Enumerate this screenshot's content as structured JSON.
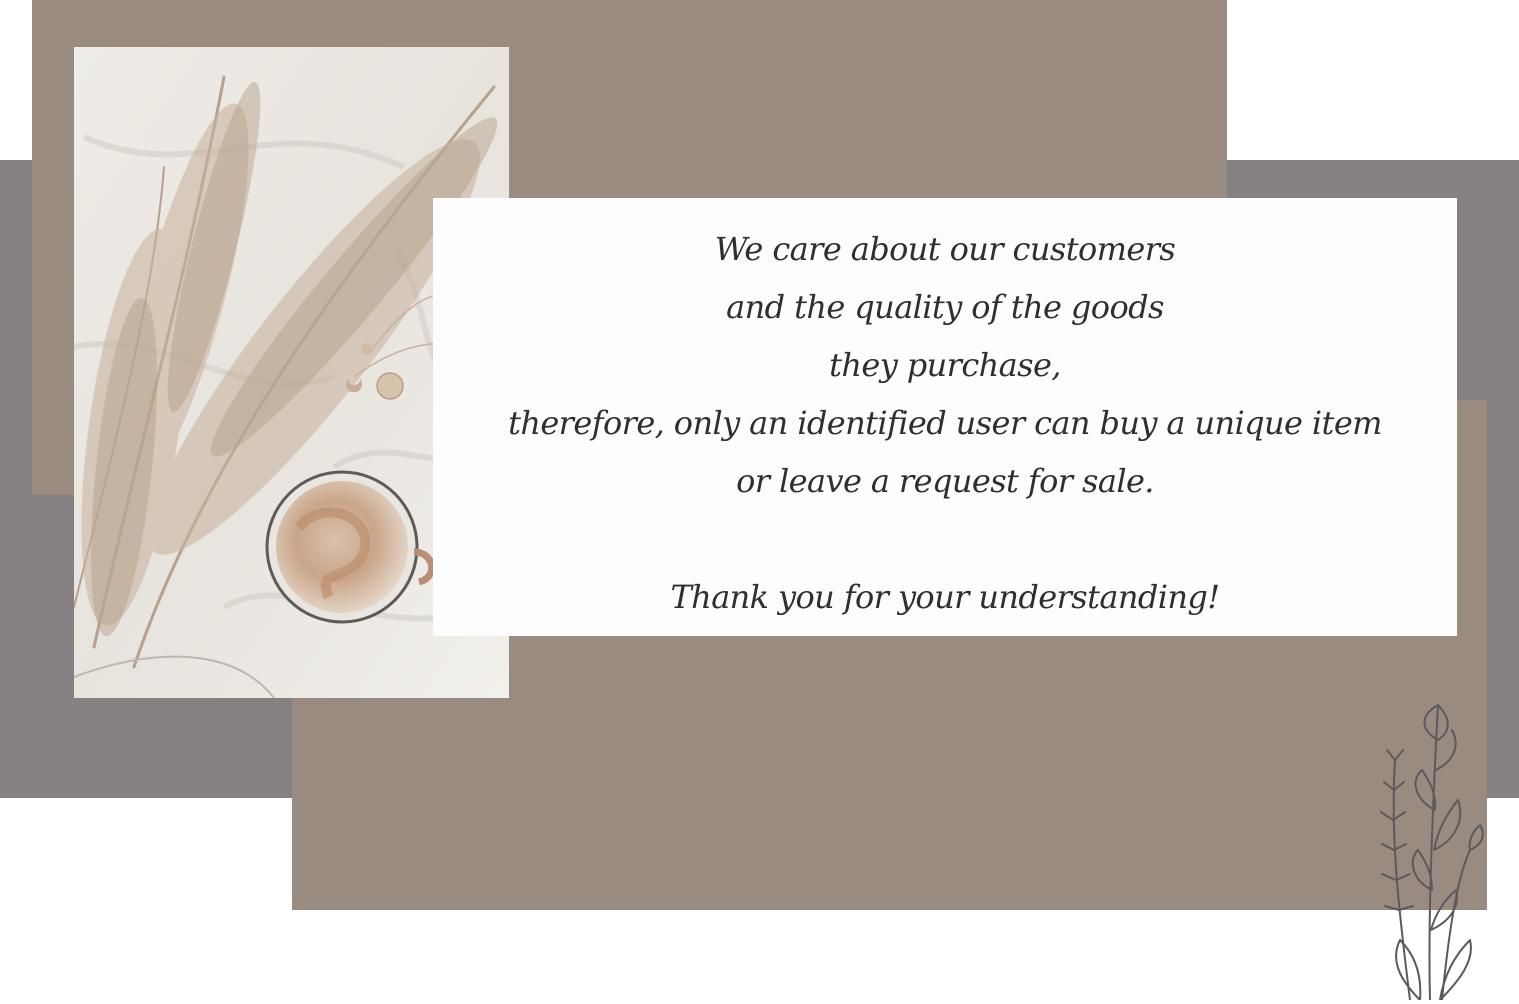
{
  "message": {
    "lines": [
      "We care about our customers",
      "and the quality of the goods",
      "they purchase,",
      "therefore, only an identified user can buy a unique item",
      "or leave a request for sale."
    ],
    "thanks": "Thank you for your understanding!"
  },
  "colors": {
    "background": "#ffffff",
    "grey_block": "#858081",
    "taupe_block": "#9a8b80",
    "card": "#fdfdfd",
    "text": "#2f2f33"
  },
  "icons": {
    "decor": "wildflower-sprig-icon"
  }
}
